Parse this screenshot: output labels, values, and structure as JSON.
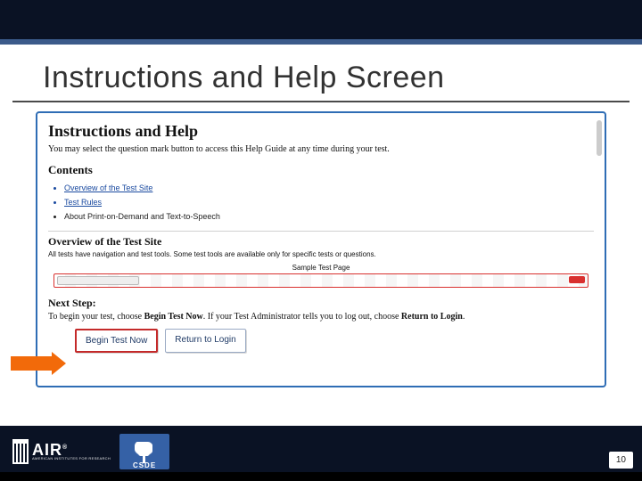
{
  "slide": {
    "title": "Instructions and Help Screen",
    "page_number": "10"
  },
  "screenshot": {
    "heading": "Instructions and Help",
    "intro": "You may select the question mark button to access this Help Guide at any time during your test.",
    "contents_heading": "Contents",
    "contents": [
      "Overview of the Test Site",
      "Test Rules",
      "About Print-on-Demand and Text-to-Speech"
    ],
    "overview_heading": "Overview of the Test Site",
    "overview_text": "All tests have navigation and test tools. Some test tools are available only for specific tests or questions.",
    "sample_caption": "Sample Test Page",
    "next_step_heading": "Next Step:",
    "next_step_text_a": "To begin your test, choose ",
    "next_step_bold_a": "Begin Test Now",
    "next_step_text_b": ". If your Test Administrator tells you to log out, choose ",
    "next_step_bold_b": "Return to Login",
    "next_step_text_c": ".",
    "buttons": {
      "begin": "Begin Test Now",
      "return": "Return to Login"
    }
  },
  "footer": {
    "air_text": "AIR",
    "air_sub": "AMERICAN INSTITUTES FOR RESEARCH",
    "air_reg": "®",
    "csde_text": "CSDE"
  }
}
